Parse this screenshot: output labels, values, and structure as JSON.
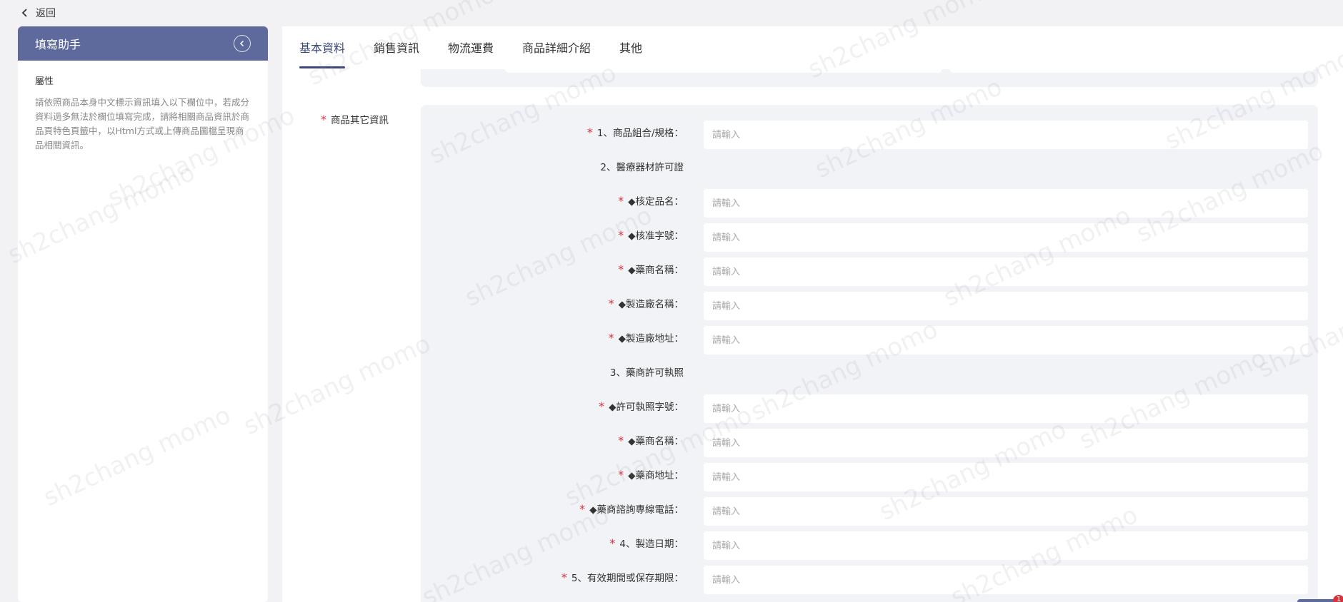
{
  "topbar": {
    "back_label": "返回"
  },
  "helper": {
    "title": "填寫助手",
    "section_title": "屬性",
    "description": "請依照商品本身中文標示資訊填入以下欄位中，若成分資料過多無法於欄位填寫完成，請將相關商品資訊於商品頁特色頁籤中，以Html方式或上傳商品圖檔呈現商品相關資訊。"
  },
  "tabs": [
    {
      "label": "基本資料",
      "active": true
    },
    {
      "label": "銷售資訊",
      "active": false
    },
    {
      "label": "物流運費",
      "active": false
    },
    {
      "label": "商品詳細介紹",
      "active": false
    },
    {
      "label": "其他",
      "active": false
    }
  ],
  "section": {
    "label": "商品其它資訊",
    "required_mark": "*"
  },
  "placeholder": "請輸入",
  "fields": [
    {
      "label": "1、商品組合/規格：",
      "required": true,
      "input": true
    },
    {
      "label": "2、醫療器材許可證",
      "required": false,
      "input": false
    },
    {
      "label": "◆核定品名：",
      "required": true,
      "input": true
    },
    {
      "label": "◆核准字號：",
      "required": true,
      "input": true
    },
    {
      "label": "◆藥商名稱：",
      "required": true,
      "input": true
    },
    {
      "label": "◆製造廠名稱：",
      "required": true,
      "input": true
    },
    {
      "label": "◆製造廠地址：",
      "required": true,
      "input": true
    },
    {
      "label": "3、藥商許可執照",
      "required": false,
      "input": false
    },
    {
      "label": "◆許可執照字號：",
      "required": true,
      "input": true
    },
    {
      "label": "◆藥商名稱：",
      "required": true,
      "input": true
    },
    {
      "label": "◆藥商地址：",
      "required": true,
      "input": true
    },
    {
      "label": "◆藥商諮詢專線電話：",
      "required": true,
      "input": true
    },
    {
      "label": "4、製造日期：",
      "required": true,
      "input": true
    },
    {
      "label": "5、有效期間或保存期限：",
      "required": true,
      "input": true
    }
  ],
  "watermark_text": "sh2chang momo",
  "badge": {
    "count": "1"
  },
  "colors": {
    "accent": "#5e6a9b",
    "required": "#d9323a",
    "tab_active": "#3b4778"
  }
}
